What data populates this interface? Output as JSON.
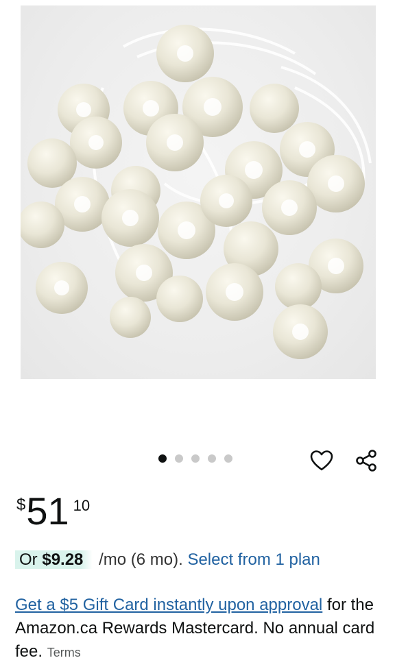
{
  "carousel": {
    "total_images": 5,
    "active_index": 0
  },
  "icons": {
    "favorite": "heart-outline-icon",
    "share": "share-icon"
  },
  "price": {
    "currency": "$",
    "whole": "51",
    "fraction": "10"
  },
  "installment": {
    "prefix": "Or",
    "amount": "$9.28",
    "period": "/mo (6 mo).",
    "link": "Select from 1 plan"
  },
  "promo": {
    "link": "Get a $5 Gift Card instantly upon approval",
    "text": "for the Amazon.ca Rewards Mastercard. No annual card fee.",
    "terms": "Terms"
  },
  "colors": {
    "link": "#2162a1",
    "highlight": "#d9f3ec",
    "text": "#0f1111"
  }
}
